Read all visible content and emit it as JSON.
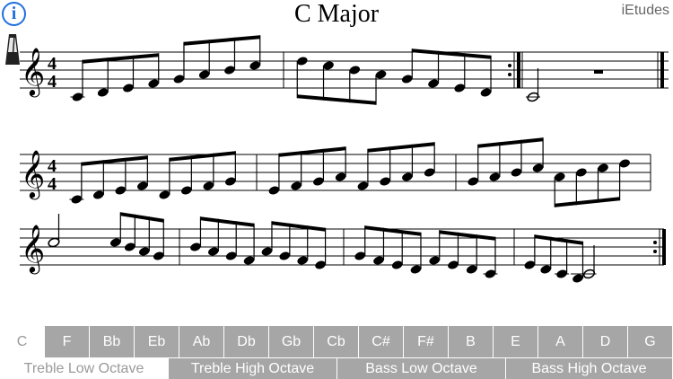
{
  "header": {
    "info_label": "i",
    "title": "C Major",
    "brand": "iEtudes"
  },
  "keys": [
    {
      "label": "C",
      "selected": true
    },
    {
      "label": "F"
    },
    {
      "label": "Bb"
    },
    {
      "label": "Eb"
    },
    {
      "label": "Ab"
    },
    {
      "label": "Db"
    },
    {
      "label": "Gb"
    },
    {
      "label": "Cb"
    },
    {
      "label": "C#"
    },
    {
      "label": "F#"
    },
    {
      "label": "B"
    },
    {
      "label": "E"
    },
    {
      "label": "A"
    },
    {
      "label": "D"
    },
    {
      "label": "G"
    }
  ],
  "octaves": [
    {
      "label": "Treble Low Octave",
      "selected": true
    },
    {
      "label": "Treble High Octave"
    },
    {
      "label": "Bass Low Octave"
    },
    {
      "label": "Bass High Octave"
    }
  ],
  "score": {
    "clef": "treble",
    "time_signature": "4/4",
    "systems": [
      [
        [
          "C4",
          "D4",
          "E4",
          "F4",
          "G4",
          "A4",
          "B4",
          "C5"
        ],
        [
          "D5",
          "C5",
          "B4",
          "A4",
          "G4",
          "F4",
          "E4",
          "D4"
        ],
        [
          "C4:half"
        ]
      ],
      [
        [
          "C4",
          "D4",
          "E4",
          "F4",
          "D4",
          "E4",
          "F4",
          "G4"
        ],
        [
          "E4",
          "F4",
          "G4",
          "A4",
          "F4",
          "G4",
          "A4",
          "B4"
        ],
        [
          "G4",
          "A4",
          "B4",
          "C5",
          "A4",
          "B4",
          "C5",
          "D5"
        ]
      ],
      [
        [
          "C5:half",
          "C5",
          "B4",
          "A4",
          "G4"
        ],
        [
          "B4",
          "A4",
          "G4",
          "F4",
          "A4",
          "G4",
          "F4",
          "E4"
        ],
        [
          "G4",
          "F4",
          "E4",
          "D4",
          "F4",
          "E4",
          "D4",
          "C4"
        ],
        [
          "E4",
          "D4",
          "C4",
          "B3",
          "C4:half"
        ]
      ]
    ]
  },
  "colors": {
    "accent": "#1f6fe0",
    "key_bg": "#a6a6a6",
    "key_text": "#ffffff",
    "selected_text": "#9a9a9a"
  }
}
